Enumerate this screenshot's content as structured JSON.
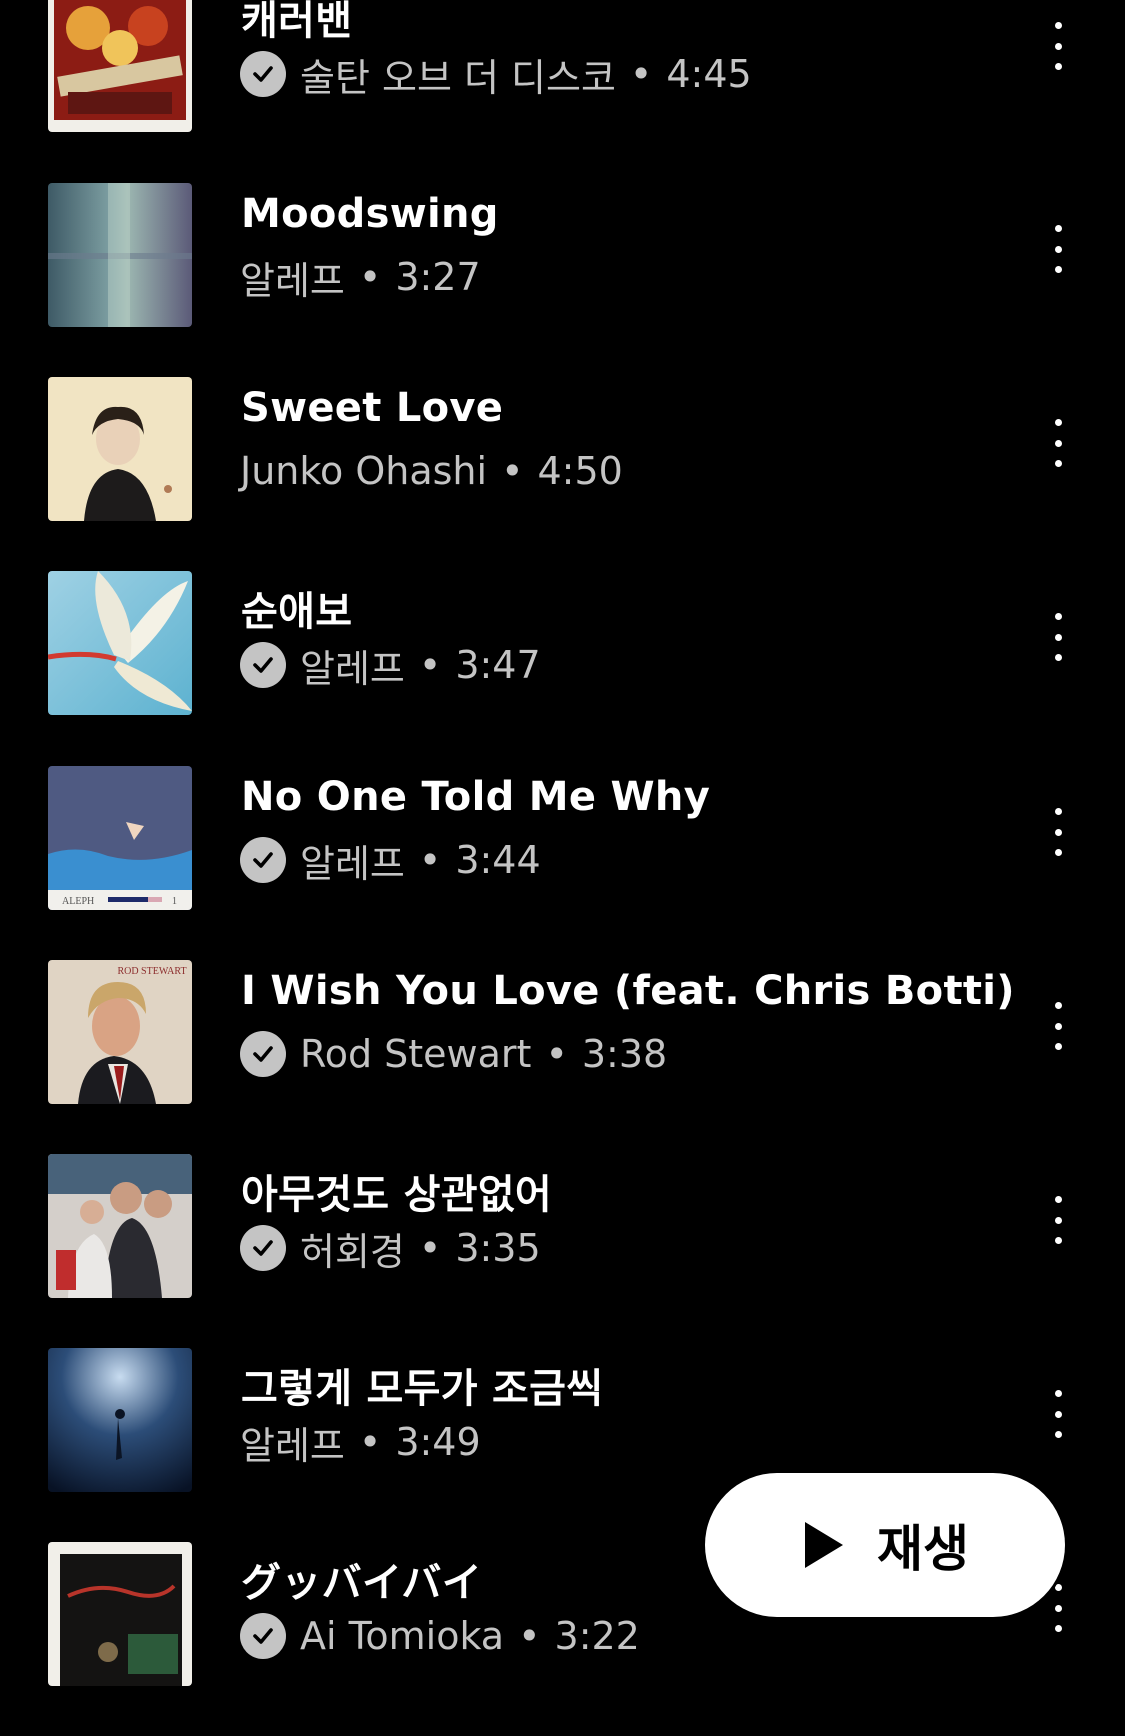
{
  "tracks": [
    {
      "title": "캐러밴",
      "artist": "술탄 오브 더 디스코",
      "duration": "4:45",
      "downloaded": true,
      "art": "art-goldenage"
    },
    {
      "title": "Moodswing",
      "artist": "알레프",
      "duration": "3:27",
      "downloaded": false,
      "art": "art-moodswing"
    },
    {
      "title": "Sweet Love",
      "artist": "Junko Ohashi",
      "duration": "4:50",
      "downloaded": false,
      "art": "art-junko"
    },
    {
      "title": "순애보",
      "artist": "알레프",
      "duration": "3:47",
      "downloaded": true,
      "art": "art-flower"
    },
    {
      "title": "No One Told Me Why",
      "artist": "알레프",
      "duration": "3:44",
      "downloaded": true,
      "art": "art-aleph",
      "art_text": "ALEPH",
      "art_number": "1"
    },
    {
      "title": "I Wish You Love (feat. Chris Botti)",
      "artist": "Rod Stewart",
      "duration": "3:38",
      "downloaded": true,
      "art": "art-rod",
      "art_text": "ROD STEWART"
    },
    {
      "title": "아무것도 상관없어",
      "artist": "허회경",
      "duration": "3:35",
      "downloaded": true,
      "art": "art-family"
    },
    {
      "title": "그렇게 모두가 조금씩",
      "artist": "알레프",
      "duration": "3:49",
      "downloaded": false,
      "art": "art-underwater"
    },
    {
      "title": "グッバイバイ",
      "artist": "Ai Tomioka",
      "duration": "3:22",
      "downloaded": true,
      "art": "art-goodbye"
    }
  ],
  "separator": "•",
  "icons": {
    "downloaded": "check-circle-icon",
    "more": "more-vertical-icon",
    "play": "play-icon"
  },
  "play_button": {
    "label": "재생"
  }
}
